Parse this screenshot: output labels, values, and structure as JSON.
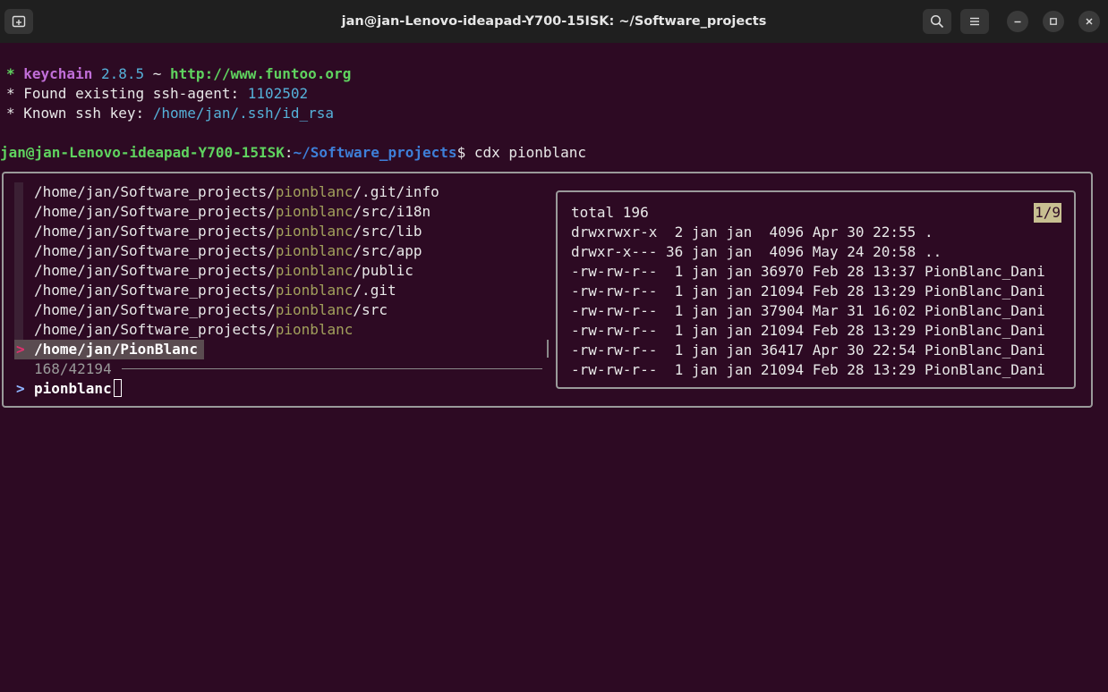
{
  "window": {
    "title": "jan@jan-Lenovo-ideapad-Y700-15ISK: ~/Software_projects",
    "icons": [
      "new-tab-icon",
      "search-icon",
      "hamburger-menu-icon",
      "minimize-icon",
      "maximize-icon",
      "close-icon"
    ]
  },
  "keychain": {
    "line1": {
      "star": "* ",
      "name": "keychain",
      "version": " 2.8.5",
      "tilde": " ~ ",
      "url": "http://www.funtoo.org"
    },
    "line2": {
      "prefix": "* Found existing ssh-agent: ",
      "value": "1102502"
    },
    "line3": {
      "prefix": "* Known ssh key: ",
      "value": "/home/jan/.ssh/id_rsa"
    }
  },
  "prompt": {
    "host": "jan@jan-Lenovo-ideapad-Y700-15ISK",
    "colon": ":",
    "path": "~/Software_projects",
    "symbol": "$ ",
    "command": "cdx pionblanc"
  },
  "fzf": {
    "items": [
      {
        "before": "/home/jan/Software_projects/",
        "match": "pionblanc",
        "after": "/.git/info"
      },
      {
        "before": "/home/jan/Software_projects/",
        "match": "pionblanc",
        "after": "/src/i18n"
      },
      {
        "before": "/home/jan/Software_projects/",
        "match": "pionblanc",
        "after": "/src/lib"
      },
      {
        "before": "/home/jan/Software_projects/",
        "match": "pionblanc",
        "after": "/src/app"
      },
      {
        "before": "/home/jan/Software_projects/",
        "match": "pionblanc",
        "after": "/public"
      },
      {
        "before": "/home/jan/Software_projects/",
        "match": "pionblanc",
        "after": "/.git"
      },
      {
        "before": "/home/jan/Software_projects/",
        "match": "pionblanc",
        "after": "/src"
      },
      {
        "before": "/home/jan/Software_projects/",
        "match": "pionblanc",
        "after": ""
      }
    ],
    "selected_marker": ">",
    "selected": "/home/jan/PionBlanc",
    "count": "168/42194",
    "prompt_marker": ">",
    "query": "pionblanc"
  },
  "preview": {
    "counter": "1/9",
    "lines": [
      "total 196",
      "drwxrwxr-x  2 jan jan  4096 Apr 30 22:55 .",
      "drwxr-x--- 36 jan jan  4096 May 24 20:58 ..",
      "-rw-rw-r--  1 jan jan 36970 Feb 28 13:37 PionBlanc_Dani",
      "-rw-rw-r--  1 jan jan 21094 Feb 28 13:29 PionBlanc_Dani",
      "-rw-rw-r--  1 jan jan 37904 Mar 31 16:02 PionBlanc_Dani",
      "-rw-rw-r--  1 jan jan 21094 Feb 28 13:29 PionBlanc_Dani",
      "-rw-rw-r--  1 jan jan 36417 Apr 30 22:54 PionBlanc_Dani",
      "-rw-rw-r--  1 jan jan 21094 Feb 28 13:29 PionBlanc_Dani"
    ]
  }
}
